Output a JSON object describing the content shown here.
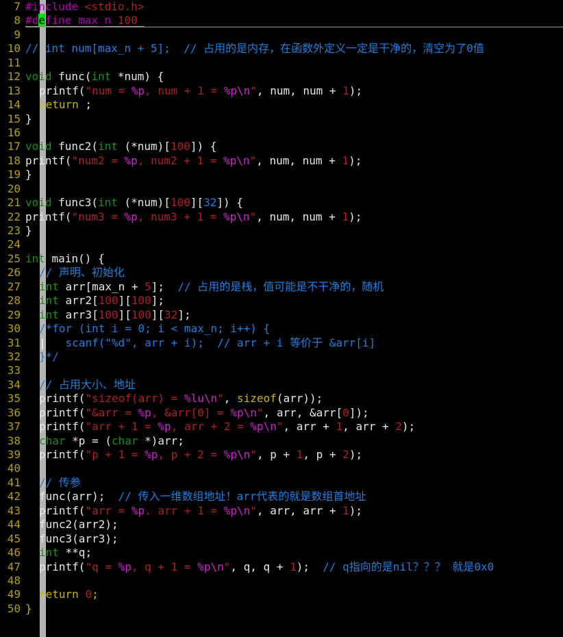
{
  "editor": {
    "name": "c-source-code-editor",
    "language": "C",
    "background": "#000000",
    "first_visible_line": 7,
    "last_visible_line": 50,
    "cursor": {
      "line": 8,
      "column": 3,
      "char": "e",
      "color": "#00e000"
    },
    "indent_guide_color": "#dcdcdc",
    "line_number_color": "#b5a000"
  },
  "colors": {
    "keyword_type": "#1a8f1a",
    "keyword_control": "#c8b400",
    "string": "#b02020",
    "format_spec": "#d020d0",
    "number": "#b02020",
    "comment": "#1e7fe0",
    "preprocessor": "#b000b0",
    "identifier": "#e8e8e8"
  },
  "lines": [
    {
      "n": "7",
      "tokens": [
        {
          "t": "#include ",
          "c": "pre"
        },
        {
          "t": "<stdio.h>",
          "c": "prestr"
        }
      ]
    },
    {
      "n": "8",
      "underline": true,
      "cursor_at": 2,
      "tokens": [
        {
          "t": "#define max_n ",
          "c": "pre"
        },
        {
          "t": "100",
          "c": "prestr"
        },
        {
          "t": " ",
          "c": "pre"
        }
      ]
    },
    {
      "n": "9",
      "tokens": []
    },
    {
      "n": "10",
      "tokens": [
        {
          "t": "// int num[max_n + 5];  // 占用的是内存，在函数外定义一定是干净的，清空为了0值",
          "c": "cmt"
        }
      ]
    },
    {
      "n": "11",
      "tokens": []
    },
    {
      "n": "12",
      "tokens": [
        {
          "t": "void",
          "c": "kw"
        },
        {
          "t": " func(",
          "c": "id"
        },
        {
          "t": "int",
          "c": "kw"
        },
        {
          "t": " *num) {",
          "c": "id"
        }
      ]
    },
    {
      "n": "13",
      "indent": 1,
      "tokens": [
        {
          "t": "printf(",
          "c": "id"
        },
        {
          "t": "\"num = ",
          "c": "str"
        },
        {
          "t": "%p",
          "c": "fmt"
        },
        {
          "t": ", num + ",
          "c": "str"
        },
        {
          "t": "1",
          "c": "num"
        },
        {
          "t": " = ",
          "c": "str"
        },
        {
          "t": "%p",
          "c": "fmt"
        },
        {
          "t": "\\n",
          "c": "fmt"
        },
        {
          "t": "\"",
          "c": "str"
        },
        {
          "t": ", num, num + ",
          "c": "id"
        },
        {
          "t": "1",
          "c": "num"
        },
        {
          "t": ");",
          "c": "id"
        }
      ]
    },
    {
      "n": "14",
      "indent": 1,
      "tokens": [
        {
          "t": "return",
          "c": "kw2"
        },
        {
          "t": " ;",
          "c": "id"
        }
      ]
    },
    {
      "n": "15",
      "tokens": [
        {
          "t": "}",
          "c": "id"
        }
      ]
    },
    {
      "n": "16",
      "tokens": []
    },
    {
      "n": "17",
      "tokens": [
        {
          "t": "void",
          "c": "kw"
        },
        {
          "t": " func2(",
          "c": "id"
        },
        {
          "t": "int",
          "c": "kw"
        },
        {
          "t": " (*num)[",
          "c": "id"
        },
        {
          "t": "100",
          "c": "num"
        },
        {
          "t": "]) {",
          "c": "id"
        }
      ]
    },
    {
      "n": "18",
      "indent": 0,
      "tokens": [
        {
          "t": "printf(",
          "c": "id"
        },
        {
          "t": "\"num2 = ",
          "c": "str"
        },
        {
          "t": "%p",
          "c": "fmt"
        },
        {
          "t": ", num2 + ",
          "c": "str"
        },
        {
          "t": "1",
          "c": "num"
        },
        {
          "t": " = ",
          "c": "str"
        },
        {
          "t": "%p",
          "c": "fmt"
        },
        {
          "t": "\\n",
          "c": "fmt"
        },
        {
          "t": "\"",
          "c": "str"
        },
        {
          "t": ", num, num + ",
          "c": "id"
        },
        {
          "t": "1",
          "c": "num"
        },
        {
          "t": ");",
          "c": "id"
        }
      ]
    },
    {
      "n": "19",
      "tokens": [
        {
          "t": "}",
          "c": "id"
        }
      ]
    },
    {
      "n": "20",
      "tokens": []
    },
    {
      "n": "21",
      "tokens": [
        {
          "t": "void",
          "c": "kw"
        },
        {
          "t": " func3(",
          "c": "id"
        },
        {
          "t": "int",
          "c": "kw"
        },
        {
          "t": " (*num)[",
          "c": "id"
        },
        {
          "t": "100",
          "c": "num"
        },
        {
          "t": "][",
          "c": "id"
        },
        {
          "t": "32",
          "c": "numb"
        },
        {
          "t": "]) {",
          "c": "id"
        }
      ]
    },
    {
      "n": "22",
      "indent": 0,
      "tokens": [
        {
          "t": "printf(",
          "c": "id"
        },
        {
          "t": "\"num3 = ",
          "c": "str"
        },
        {
          "t": "%p",
          "c": "fmt"
        },
        {
          "t": ", num3 + ",
          "c": "str"
        },
        {
          "t": "1",
          "c": "num"
        },
        {
          "t": " = ",
          "c": "str"
        },
        {
          "t": "%p",
          "c": "fmt"
        },
        {
          "t": "\\n",
          "c": "fmt"
        },
        {
          "t": "\"",
          "c": "str"
        },
        {
          "t": ", num, num + ",
          "c": "id"
        },
        {
          "t": "1",
          "c": "num"
        },
        {
          "t": ");",
          "c": "id"
        }
      ]
    },
    {
      "n": "23",
      "tokens": [
        {
          "t": "}",
          "c": "id"
        }
      ]
    },
    {
      "n": "24",
      "tokens": []
    },
    {
      "n": "25",
      "tokens": [
        {
          "t": "int",
          "c": "kw"
        },
        {
          "t": " main() {",
          "c": "id"
        }
      ]
    },
    {
      "n": "26",
      "indent": 1,
      "tokens": [
        {
          "t": "// 声明、初始化",
          "c": "cmt"
        }
      ]
    },
    {
      "n": "27",
      "indent": 1,
      "tokens": [
        {
          "t": "int",
          "c": "kw"
        },
        {
          "t": " arr[max_n + ",
          "c": "id"
        },
        {
          "t": "5",
          "c": "num"
        },
        {
          "t": "];  ",
          "c": "id"
        },
        {
          "t": "// 占用的是栈，值可能是不干净的，随机",
          "c": "cmt"
        }
      ]
    },
    {
      "n": "28",
      "indent": 1,
      "tokens": [
        {
          "t": "int",
          "c": "kw"
        },
        {
          "t": " arr2[",
          "c": "id"
        },
        {
          "t": "100",
          "c": "num"
        },
        {
          "t": "][",
          "c": "id"
        },
        {
          "t": "100",
          "c": "num"
        },
        {
          "t": "];",
          "c": "id"
        }
      ]
    },
    {
      "n": "29",
      "indent": 1,
      "tokens": [
        {
          "t": "int",
          "c": "kw"
        },
        {
          "t": " arr3[",
          "c": "id"
        },
        {
          "t": "100",
          "c": "num"
        },
        {
          "t": "][",
          "c": "id"
        },
        {
          "t": "100",
          "c": "num"
        },
        {
          "t": "][",
          "c": "id"
        },
        {
          "t": "32",
          "c": "num"
        },
        {
          "t": "];",
          "c": "id"
        }
      ]
    },
    {
      "n": "30",
      "indent": 1,
      "tokens": [
        {
          "t": "/*for (int i = 0; i < max_n; i++) {",
          "c": "cmt"
        }
      ]
    },
    {
      "n": "31",
      "indent": 1,
      "guide_bar": true,
      "tokens": [
        {
          "t": "   scanf(\"%d\", arr + i);  // arr + i 等价于 &arr[i]",
          "c": "cmt"
        }
      ]
    },
    {
      "n": "32",
      "indent": 1,
      "tokens": [
        {
          "t": "}*/",
          "c": "cmt"
        }
      ]
    },
    {
      "n": "33",
      "tokens": []
    },
    {
      "n": "34",
      "indent": 1,
      "tokens": [
        {
          "t": "// 占用大小、地址",
          "c": "cmt"
        }
      ]
    },
    {
      "n": "35",
      "indent": 1,
      "tokens": [
        {
          "t": "printf(",
          "c": "id"
        },
        {
          "t": "\"sizeof(arr) = ",
          "c": "str"
        },
        {
          "t": "%lu",
          "c": "fmt"
        },
        {
          "t": "\\n",
          "c": "fmt"
        },
        {
          "t": "\"",
          "c": "str"
        },
        {
          "t": ", ",
          "c": "id"
        },
        {
          "t": "sizeof",
          "c": "kw2"
        },
        {
          "t": "(arr));",
          "c": "id"
        }
      ]
    },
    {
      "n": "36",
      "indent": 1,
      "tokens": [
        {
          "t": "printf(",
          "c": "id"
        },
        {
          "t": "\"&arr = ",
          "c": "str"
        },
        {
          "t": "%p",
          "c": "fmt"
        },
        {
          "t": ", &arr[",
          "c": "str"
        },
        {
          "t": "0",
          "c": "num"
        },
        {
          "t": "] = ",
          "c": "str"
        },
        {
          "t": "%p",
          "c": "fmt"
        },
        {
          "t": "\\n",
          "c": "fmt"
        },
        {
          "t": "\"",
          "c": "str"
        },
        {
          "t": ", arr, &arr[",
          "c": "id"
        },
        {
          "t": "0",
          "c": "num"
        },
        {
          "t": "]);",
          "c": "id"
        }
      ]
    },
    {
      "n": "37",
      "indent": 1,
      "tokens": [
        {
          "t": "printf(",
          "c": "id"
        },
        {
          "t": "\"arr + ",
          "c": "str"
        },
        {
          "t": "1",
          "c": "num"
        },
        {
          "t": " = ",
          "c": "str"
        },
        {
          "t": "%p",
          "c": "fmt"
        },
        {
          "t": ", arr + ",
          "c": "str"
        },
        {
          "t": "2",
          "c": "num"
        },
        {
          "t": " = ",
          "c": "str"
        },
        {
          "t": "%p",
          "c": "fmt"
        },
        {
          "t": "\\n",
          "c": "fmt"
        },
        {
          "t": "\"",
          "c": "str"
        },
        {
          "t": ", arr + ",
          "c": "id"
        },
        {
          "t": "1",
          "c": "num"
        },
        {
          "t": ", arr + ",
          "c": "id"
        },
        {
          "t": "2",
          "c": "num"
        },
        {
          "t": ");",
          "c": "id"
        }
      ]
    },
    {
      "n": "38",
      "indent": 1,
      "tokens": [
        {
          "t": "char",
          "c": "kw"
        },
        {
          "t": " *p = (",
          "c": "id"
        },
        {
          "t": "char",
          "c": "kw"
        },
        {
          "t": " *)arr;",
          "c": "id"
        }
      ]
    },
    {
      "n": "39",
      "indent": 1,
      "tokens": [
        {
          "t": "printf(",
          "c": "id"
        },
        {
          "t": "\"p + ",
          "c": "str"
        },
        {
          "t": "1",
          "c": "num"
        },
        {
          "t": " = ",
          "c": "str"
        },
        {
          "t": "%p",
          "c": "fmt"
        },
        {
          "t": ", p + ",
          "c": "str"
        },
        {
          "t": "2",
          "c": "num"
        },
        {
          "t": " = ",
          "c": "str"
        },
        {
          "t": "%p",
          "c": "fmt"
        },
        {
          "t": "\\n",
          "c": "fmt"
        },
        {
          "t": "\"",
          "c": "str"
        },
        {
          "t": ", p + ",
          "c": "id"
        },
        {
          "t": "1",
          "c": "num"
        },
        {
          "t": ", p + ",
          "c": "id"
        },
        {
          "t": "2",
          "c": "num"
        },
        {
          "t": ");",
          "c": "id"
        }
      ]
    },
    {
      "n": "40",
      "tokens": []
    },
    {
      "n": "41",
      "indent": 1,
      "tokens": [
        {
          "t": "// 传参",
          "c": "cmt"
        }
      ]
    },
    {
      "n": "42",
      "indent": 1,
      "tokens": [
        {
          "t": "func(arr);  ",
          "c": "id"
        },
        {
          "t": "// 传入一维数组地址！arr代表的就是数组首地址",
          "c": "cmt"
        }
      ]
    },
    {
      "n": "43",
      "indent": 1,
      "tokens": [
        {
          "t": "printf(",
          "c": "id"
        },
        {
          "t": "\"arr = ",
          "c": "str"
        },
        {
          "t": "%p",
          "c": "fmt"
        },
        {
          "t": ". arr + ",
          "c": "str"
        },
        {
          "t": "1",
          "c": "num"
        },
        {
          "t": " = ",
          "c": "str"
        },
        {
          "t": "%p",
          "c": "fmt"
        },
        {
          "t": "\\n",
          "c": "fmt"
        },
        {
          "t": "\"",
          "c": "str"
        },
        {
          "t": ", arr, arr + ",
          "c": "id"
        },
        {
          "t": "1",
          "c": "num"
        },
        {
          "t": ");",
          "c": "id"
        }
      ]
    },
    {
      "n": "44",
      "indent": 1,
      "tokens": [
        {
          "t": "func2(arr2);",
          "c": "id"
        }
      ]
    },
    {
      "n": "45",
      "indent": 1,
      "tokens": [
        {
          "t": "func3(arr3);",
          "c": "id"
        }
      ]
    },
    {
      "n": "46",
      "indent": 1,
      "tokens": [
        {
          "t": "int",
          "c": "kw"
        },
        {
          "t": " **q;",
          "c": "id"
        }
      ]
    },
    {
      "n": "47",
      "indent": 1,
      "tokens": [
        {
          "t": "printf(",
          "c": "id"
        },
        {
          "t": "\"q = ",
          "c": "str"
        },
        {
          "t": "%p",
          "c": "fmt"
        },
        {
          "t": ", q + ",
          "c": "str"
        },
        {
          "t": "1",
          "c": "num"
        },
        {
          "t": " = ",
          "c": "str"
        },
        {
          "t": "%p",
          "c": "fmt"
        },
        {
          "t": "\\n",
          "c": "fmt"
        },
        {
          "t": "\"",
          "c": "str"
        },
        {
          "t": ", q, q + ",
          "c": "id"
        },
        {
          "t": "1",
          "c": "num"
        },
        {
          "t": ");  ",
          "c": "id"
        },
        {
          "t": "// q指向的是nil？？？ 就是0x0",
          "c": "cmt"
        }
      ]
    },
    {
      "n": "48",
      "tokens": []
    },
    {
      "n": "49",
      "indent": 1,
      "tokens": [
        {
          "t": "return",
          "c": "kw2"
        },
        {
          "t": " ",
          "c": "id"
        },
        {
          "t": "0",
          "c": "num"
        },
        {
          "t": ";",
          "c": "kw2"
        }
      ]
    },
    {
      "n": "50",
      "tokens": [
        {
          "t": "}",
          "c": "kw2"
        }
      ]
    }
  ]
}
